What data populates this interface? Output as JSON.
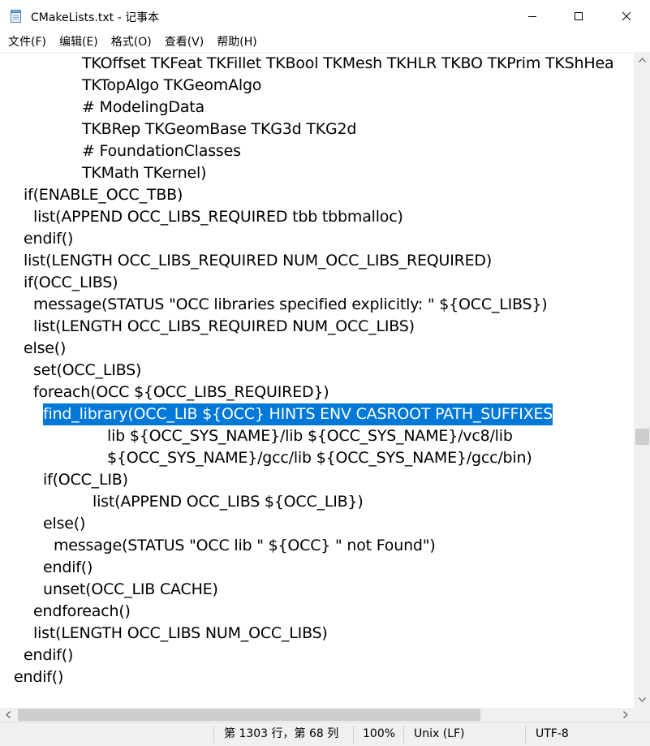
{
  "window": {
    "title": "CMakeLists.txt - 记事本",
    "minimize_label": "",
    "maximize_label": "",
    "close_label": ""
  },
  "menu": {
    "items": [
      {
        "label": "文件(F)"
      },
      {
        "label": "编辑(E)"
      },
      {
        "label": "格式(O)"
      },
      {
        "label": "查看(V)"
      },
      {
        "label": "帮助(H)"
      }
    ]
  },
  "editor": {
    "lines": [
      "TKOffset TKFeat TKFillet TKBool TKMesh TKHLR TKBO TKPrim TKShHea",
      "TKTopAlgo TKGeomAlgo",
      "# ModelingData",
      "TKBRep TKGeomBase TKG3d TKG2d",
      "# FoundationClasses",
      "TKMath TKernel)",
      "if(ENABLE_OCC_TBB)",
      "list(APPEND OCC_LIBS_REQUIRED tbb tbbmalloc)",
      "endif()",
      "list(LENGTH OCC_LIBS_REQUIRED NUM_OCC_LIBS_REQUIRED)",
      "if(OCC_LIBS)",
      "message(STATUS \"OCC libraries specified explicitly: \" ${OCC_LIBS})",
      "list(LENGTH OCC_LIBS_REQUIRED NUM_OCC_LIBS)",
      "else()",
      "set(OCC_LIBS)",
      "foreach(OCC ${OCC_LIBS_REQUIRED})",
      "find_library(OCC_LIB ${OCC} HINTS ENV CASROOT PATH_SUFFIXES",
      "lib ${OCC_SYS_NAME}/lib ${OCC_SYS_NAME}/vc8/lib",
      "${OCC_SYS_NAME}/gcc/lib ${OCC_SYS_NAME}/gcc/bin)",
      "if(OCC_LIB)",
      "list(APPEND OCC_LIBS ${OCC_LIB})",
      "else()",
      "message(STATUS \"OCC lib \" ${OCC} \" not Found\")",
      "endif()",
      "unset(OCC_LIB CACHE)",
      "endforeach()",
      "list(LENGTH OCC_LIBS NUM_OCC_LIBS)",
      "endif()",
      "endif()"
    ],
    "selected_line": "find_library(OCC_LIB ${OCC} HINTS ENV CASROOT PATH_SUFFIXES",
    "selection_color": "#0078d7"
  },
  "status": {
    "position": "第 1303 行，第 68 列",
    "zoom": "100%",
    "line_ending": "Unix (LF)",
    "encoding": "UTF-8"
  },
  "colors": {
    "chrome_bg": "#f0f0f0",
    "scroll_thumb": "#cdcdcd",
    "text": "#000000"
  }
}
